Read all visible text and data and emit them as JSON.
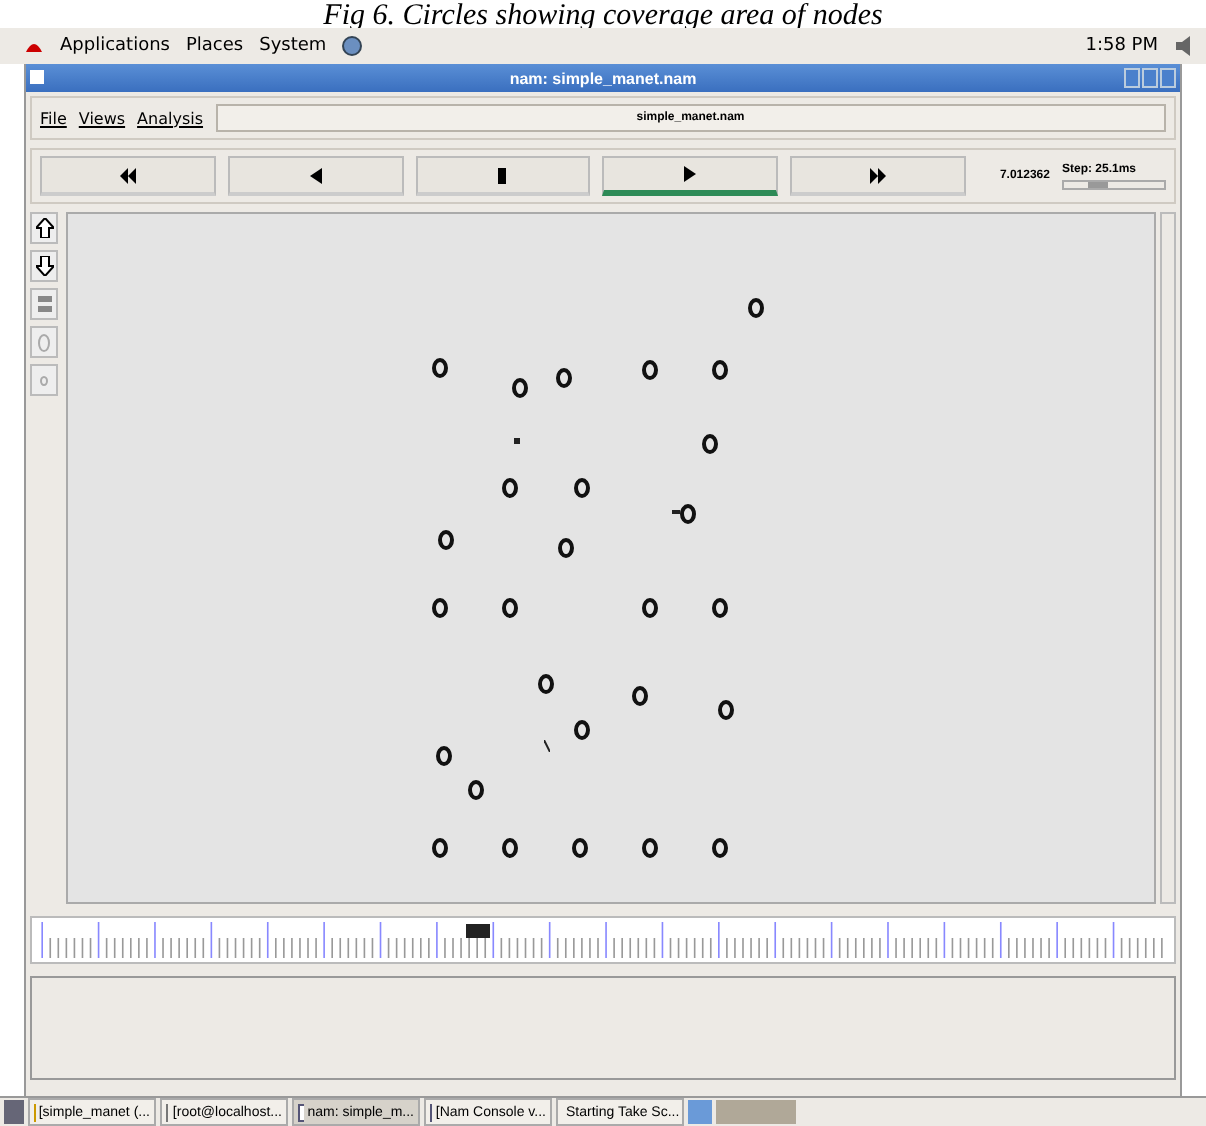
{
  "caption": "Fig 6.  Circles showing coverage area of nodes",
  "panel": {
    "menus": [
      "Applications",
      "Places",
      "System"
    ],
    "clock": "1:58 PM"
  },
  "window": {
    "title": "nam: simple_manet.nam"
  },
  "menu": [
    "File",
    "Views",
    "Analysis"
  ],
  "file_field": {
    "value": "simple_manet.nam"
  },
  "controls": [
    {
      "kind": "rewind",
      "selected": false
    },
    {
      "kind": "back",
      "selected": false
    },
    {
      "kind": "stop",
      "selected": false
    },
    {
      "kind": "play",
      "selected": true
    },
    {
      "kind": "forward",
      "selected": false
    }
  ],
  "time": "7.012362",
  "step": {
    "label": "Step: 25.1ms",
    "level": 0.35
  },
  "timeline": {
    "level": 0.39
  },
  "taskbar": [
    {
      "label": "[simple_manet (...",
      "kind": "doc",
      "selected": false
    },
    {
      "label": "[root@localhost...",
      "kind": "term",
      "selected": false
    },
    {
      "label": "nam: simple_m...",
      "kind": "win",
      "selected": true
    },
    {
      "label": "[Nam Console v...",
      "kind": "win",
      "selected": false
    },
    {
      "label": "Starting Take Sc...",
      "kind": "cam",
      "selected": false
    }
  ]
}
